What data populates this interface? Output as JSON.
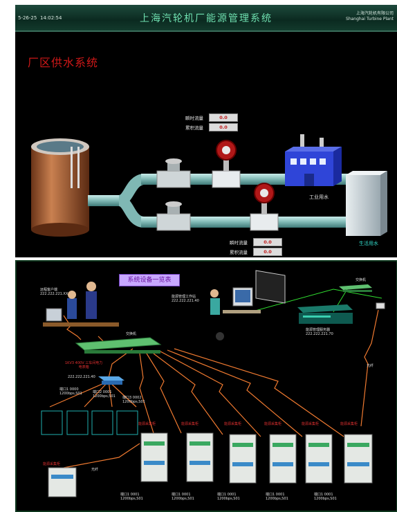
{
  "header": {
    "date": "5-26-25",
    "time": "14:02:54",
    "title": "上海汽轮机厂能源管理系统",
    "company_cn": "上海汽轮机有限公司",
    "company_en": "Shanghai Turbine Plant"
  },
  "water_system": {
    "title": "厂区供水系统",
    "industrial_water_label": "工业用水",
    "domestic_water_label": "生活用水",
    "meter_top": {
      "instant_flow_label": "瞬时流量",
      "instant_flow_value": "0.0",
      "total_flow_label": "累积流量",
      "total_flow_value": "0.0"
    },
    "meter_bottom": {
      "instant_flow_label": "瞬时流量",
      "instant_flow_value": "0.0",
      "total_flow_label": "累积流量",
      "total_flow_value": "0.0"
    }
  },
  "network": {
    "banner": "系统设备一览表",
    "remote_client_label": "远程客户端",
    "remote_client_ip": "222.222.221.XX",
    "mgmt_station_label": "能源管理工作站",
    "mgmt_station_ip": "222.222.221.40",
    "mgmt_server_label": "能源管理服务器",
    "mgmt_server_ip": "222.222.221.70",
    "switch_label": "交换机",
    "switch_right_label": "交换机",
    "fiber_label": "光纤",
    "converter_label": "1KV3 400V 三车间电力",
    "converter_label2": "电表箱",
    "converter_ip": "222.222.221.40",
    "converter_ports": [
      "端口1 0000",
      "端口2 0001",
      "端口3 0002"
    ],
    "converter_rates": [
      "1200bps,S01",
      "1200bps,S01",
      "1200bps,S01"
    ],
    "cabinet_labels": [
      "能源采集柜",
      "能源采集柜",
      "能源采集柜",
      "能源采集柜",
      "能源采集柜",
      "能源采集柜"
    ],
    "cabinet_ports": [
      "端口1 0001",
      "端口1 0001",
      "端口1 0001",
      "端口1 0001",
      "端口1 0001"
    ],
    "cabinet_rates": [
      "1200bps,S01",
      "1200bps,S01",
      "1200bps,S01",
      "1200bps,S01",
      "1200bps,S01"
    ],
    "small_cabinet_label": "能源采集柜"
  },
  "colors": {
    "header_green": "#6fe0b0",
    "title_red": "#d01818",
    "pipe": "#7fb8b4",
    "tank": "#b06a3c",
    "building_blue": "#2f45d8",
    "link_orange": "#f07a30",
    "link_green": "#30e030"
  }
}
